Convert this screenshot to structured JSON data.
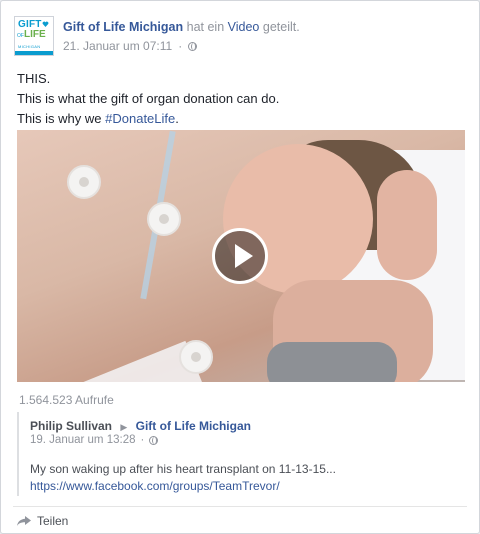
{
  "post": {
    "page_name": "Gift of Life Michigan",
    "action_text": "hat ein",
    "action_link": "Video",
    "action_suffix": "geteilt.",
    "timestamp": "21. Januar um 07:11",
    "dot": "·",
    "text_lines": [
      "THIS.",
      "This is what the gift of organ donation can do."
    ],
    "text_line3_prefix": "This is why we ",
    "hashtag": "#DonateLife",
    "text_line3_suffix": "."
  },
  "logo": {
    "gift": "GIFT",
    "of": "OF",
    "life": "LIFE",
    "michigan": "MICHIGAN",
    "colors": {
      "blue": "#0a9ccf",
      "green": "#6ab04c"
    }
  },
  "video": {
    "views": "1.564.523 Aufrufe",
    "play_icon": "play-icon"
  },
  "shared": {
    "original_poster": "Philip Sullivan",
    "arrow": "▶",
    "target": "Gift of Life Michigan",
    "timestamp": "19. Januar um 13:28",
    "dot": "·",
    "text": "My son waking up after his heart transplant on 11-13-15...",
    "link": "https://www.facebook.com/groups/TeamTrevor/"
  },
  "actions": {
    "share_label": "Teilen",
    "share_icon": "share-arrow-icon"
  },
  "colors": {
    "link": "#365899",
    "meta": "#90949c",
    "text": "#1d2129"
  }
}
